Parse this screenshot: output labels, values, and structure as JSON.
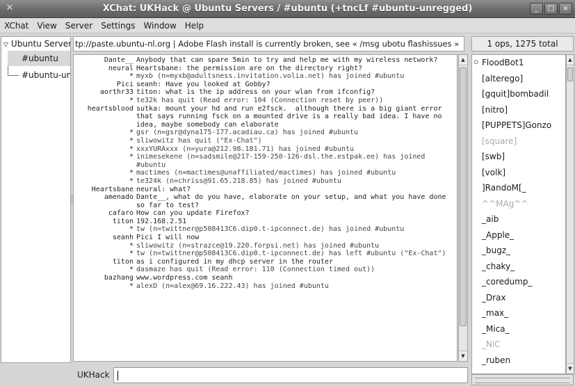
{
  "window": {
    "title": "XChat: UKHack @ Ubuntu Servers / #ubuntu (+tncLf #ubuntu-unregged)",
    "buttons": {
      "minimize": "_",
      "maximize": "□",
      "close": "×"
    }
  },
  "menu": [
    "XChat",
    "View",
    "Server",
    "Settings",
    "Window",
    "Help"
  ],
  "sidebar": {
    "root": "Ubuntu Servers",
    "channels": [
      "#ubuntu",
      "#ubuntu-unregged"
    ]
  },
  "topic": "tp://paste.ubuntu-nl.org | Adobe Flash install is currently broken, see « /msg ubotu flashissues »",
  "users_count": "1 ops, 1275 total",
  "chat": [
    {
      "nick": "Dante__",
      "text": "Anybody that can spare 5min to try and help me with my wireless network?"
    },
    {
      "nick": "neural",
      "text": "Heartsbane: the permission are on the directory right?"
    },
    {
      "nick": "*",
      "text": "myxb (n=myxb@adultsness.invitation.volia.net) has joined #ubuntu",
      "system": true
    },
    {
      "nick": "Pici",
      "text": "seanh: Have you looked at Gobby?"
    },
    {
      "nick": "aorthr33",
      "text": "titon: what is the ip address on your wlan from ifconfig?"
    },
    {
      "nick": "*",
      "text": "te32k has quit (Read error: 104 (Connection reset by peer))",
      "system": true
    },
    {
      "nick": "heartsblood",
      "text": "sutka: mount your hd and run e2fsck.  although there is a big giant error that says running fsck on a mounted drive is a really bad idea. I have no idea, maybe somebody can elaborate"
    },
    {
      "nick": "*",
      "text": "gsr (n=gsr@dyna175-177.acadiau.ca) has joined #ubuntu",
      "system": true
    },
    {
      "nick": "*",
      "text": "sliwowitz has quit (\"Ex-Chat\")",
      "system": true
    },
    {
      "nick": "*",
      "text": "xxxYURAxxx (n=yura@212.98.181.71) has joined #ubuntu",
      "system": true
    },
    {
      "nick": "*",
      "text": "inimesekene (n=sadsmile@217-159-250-126-dsl.the.estpak.ee) has joined #ubuntu",
      "system": true
    },
    {
      "nick": "*",
      "text": "mactimes (n=mactimes@unaffiliated/mactimes) has joined #ubuntu",
      "system": true
    },
    {
      "nick": "*",
      "text": "te324k (n=chriss@91.65.218.85) has joined #ubuntu",
      "system": true
    },
    {
      "nick": "Heartsbane",
      "text": "neural: what?"
    },
    {
      "nick": "amenado",
      "text": "Dante__, what do you have, elaborate on your setup, and what you have done so far to test?"
    },
    {
      "nick": "cafaro",
      "text": "How can you update Firefox?"
    },
    {
      "nick": "titon",
      "text": "192.168.2.51"
    },
    {
      "nick": "*",
      "text": "tw (n=twittner@p508413C6.dip0.t-ipconnect.de) has joined #ubuntu",
      "system": true
    },
    {
      "nick": "seanh",
      "text": "Pici I will now"
    },
    {
      "nick": "*",
      "text": "sliwowitz (n=strazce@19.220.forpsi.net) has joined #ubuntu",
      "system": true
    },
    {
      "nick": "*",
      "text": "tw (n=twittner@p508413C6.dip0.t-ipconnect.de) has left #ubuntu (\"Ex-Chat\")",
      "system": true
    },
    {
      "nick": "titon",
      "text": "as i configured in my dhcp server in the router"
    },
    {
      "nick": "*",
      "text": "dasmaze has quit (Read error: 110 (Connection timed out))",
      "system": true
    },
    {
      "nick": "bazhang",
      "text": "www.wordpress.com seanh"
    },
    {
      "nick": "*",
      "text": "alexD (n=alex@69.16.222.43) has joined #ubuntu",
      "system": true
    }
  ],
  "users": [
    {
      "name": "FloodBot1",
      "op": true
    },
    {
      "name": "[alterego]"
    },
    {
      "name": "[gquit]bombadil"
    },
    {
      "name": "[nitro]"
    },
    {
      "name": "[PUPPETS]Gonzo"
    },
    {
      "name": "[square]",
      "dim": true
    },
    {
      "name": "[swb]"
    },
    {
      "name": "[volk]"
    },
    {
      "name": "]RandoM[_"
    },
    {
      "name": "^^MAg^^",
      "dim": true
    },
    {
      "name": "_aib"
    },
    {
      "name": "_Apple_"
    },
    {
      "name": "_bugz_"
    },
    {
      "name": "_chaky_"
    },
    {
      "name": "_coredump_"
    },
    {
      "name": "_Drax"
    },
    {
      "name": "_max_"
    },
    {
      "name": "_Mica_"
    },
    {
      "name": "_NiC",
      "dim": true
    },
    {
      "name": "_ruben"
    }
  ],
  "input": {
    "nick_label": "UKHack",
    "value": ""
  }
}
